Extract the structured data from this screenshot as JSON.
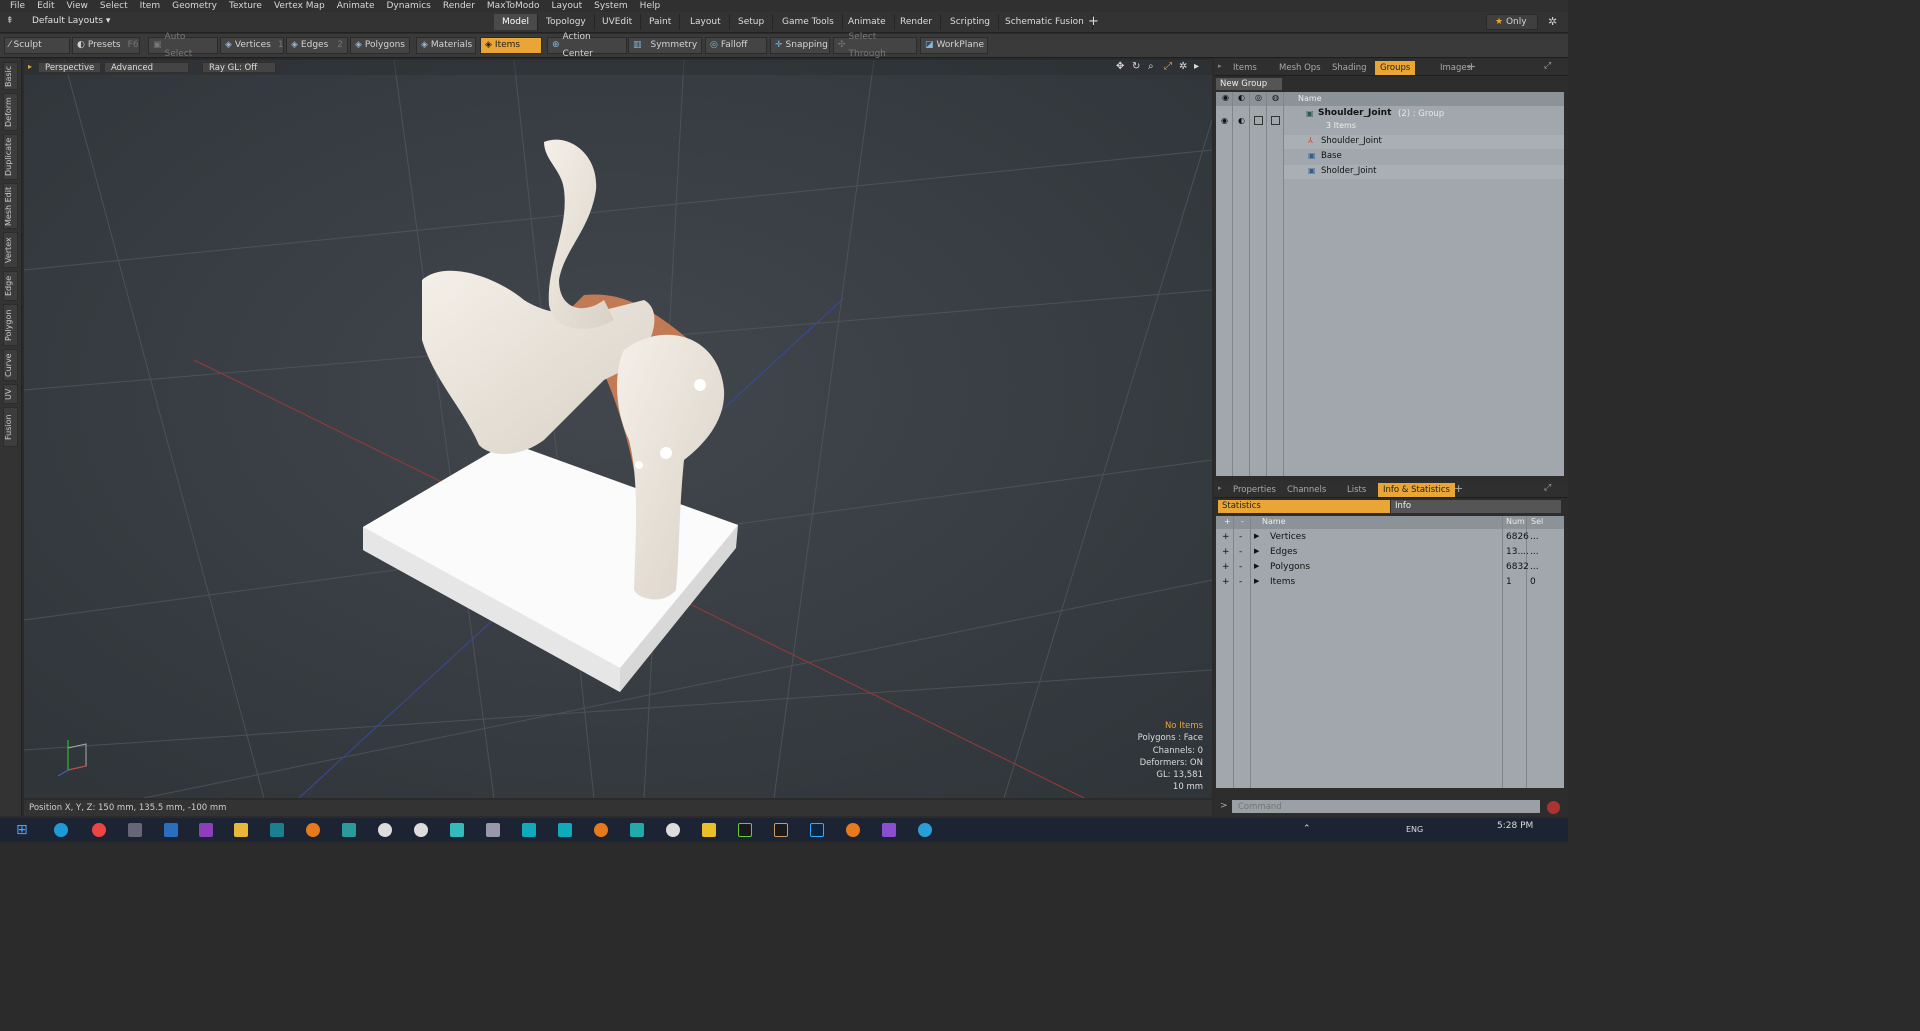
{
  "menu": [
    "File",
    "Edit",
    "View",
    "Select",
    "Item",
    "Geometry",
    "Texture",
    "Vertex Map",
    "Animate",
    "Dynamics",
    "Render",
    "MaxToModo",
    "Layout",
    "System",
    "Help"
  ],
  "layout_selector": "Default Layouts ▾",
  "layout_tabs": [
    "Model",
    "Topology",
    "UVEdit",
    "Paint",
    "Layout",
    "Setup",
    "Game Tools",
    "Animate",
    "Render",
    "Scripting",
    "Schematic Fusion"
  ],
  "layout_active": "Model",
  "only_label": "Only",
  "toolbar": {
    "sculpt": "Sculpt",
    "presets": "Presets",
    "presets_key": "F6",
    "auto_select": "Auto Select",
    "vertices": "Vertices",
    "vertices_num": "1",
    "edges": "Edges",
    "edges_num": "2",
    "polygons": "Polygons",
    "materials": "Materials",
    "items": "Items",
    "action_center": "Action Center",
    "symmetry": "Symmetry",
    "falloff": "Falloff",
    "snapping": "Snapping",
    "select_through": "Select Through",
    "workplane": "WorkPlane"
  },
  "left_tabs": [
    "Basic",
    "Deform",
    "Duplicate",
    "Mesh Edit",
    "Vertex",
    "Edge",
    "Polygon",
    "Curve",
    "UV",
    "Fusion"
  ],
  "viewport": {
    "perspective": "Perspective",
    "advanced": "Advanced",
    "raygl": "Ray GL: Off",
    "info": {
      "no_items": "No Items",
      "polygons": "Polygons : Face",
      "channels": "Channels: 0",
      "deformers": "Deformers: ON",
      "gl": "GL: 13,581",
      "scale": "10 mm"
    }
  },
  "status": "Position X, Y, Z:  150 mm, 135.5 mm, -100 mm",
  "top_panel": {
    "tabs": [
      "Items",
      "Mesh Ops",
      "Shading",
      "Groups",
      "Images"
    ],
    "active": "Groups",
    "new_group": "New Group",
    "name_header": "Name",
    "group_name": "Shoulder_Joint",
    "group_suffix": "(2) : Group",
    "group_count": "3 Items",
    "children": [
      "Shoulder_Joint",
      "Base",
      "Sholder_Joint"
    ]
  },
  "bottom_panel": {
    "tabs": [
      "Properties",
      "Channels",
      "Lists",
      "Info & Statistics"
    ],
    "active": "Info & Statistics",
    "subtabs": [
      "Statistics",
      "Info"
    ],
    "headers": {
      "name": "Name",
      "num": "Num",
      "sel": "Sel"
    },
    "rows": [
      {
        "name": "Vertices",
        "num": "6826",
        "sel": "..."
      },
      {
        "name": "Edges",
        "num": "13....",
        "sel": "..."
      },
      {
        "name": "Polygons",
        "num": "6832",
        "sel": "..."
      },
      {
        "name": "Items",
        "num": "1",
        "sel": "0"
      }
    ]
  },
  "command_placeholder": "Command",
  "taskbar": {
    "lang": "ENG",
    "time": "5:28 PM"
  },
  "colors": {
    "accent": "#e9a535",
    "bg": "#2b2b2b",
    "viewport": "#3a3f44",
    "panel_grey": "#a1a7ac"
  }
}
